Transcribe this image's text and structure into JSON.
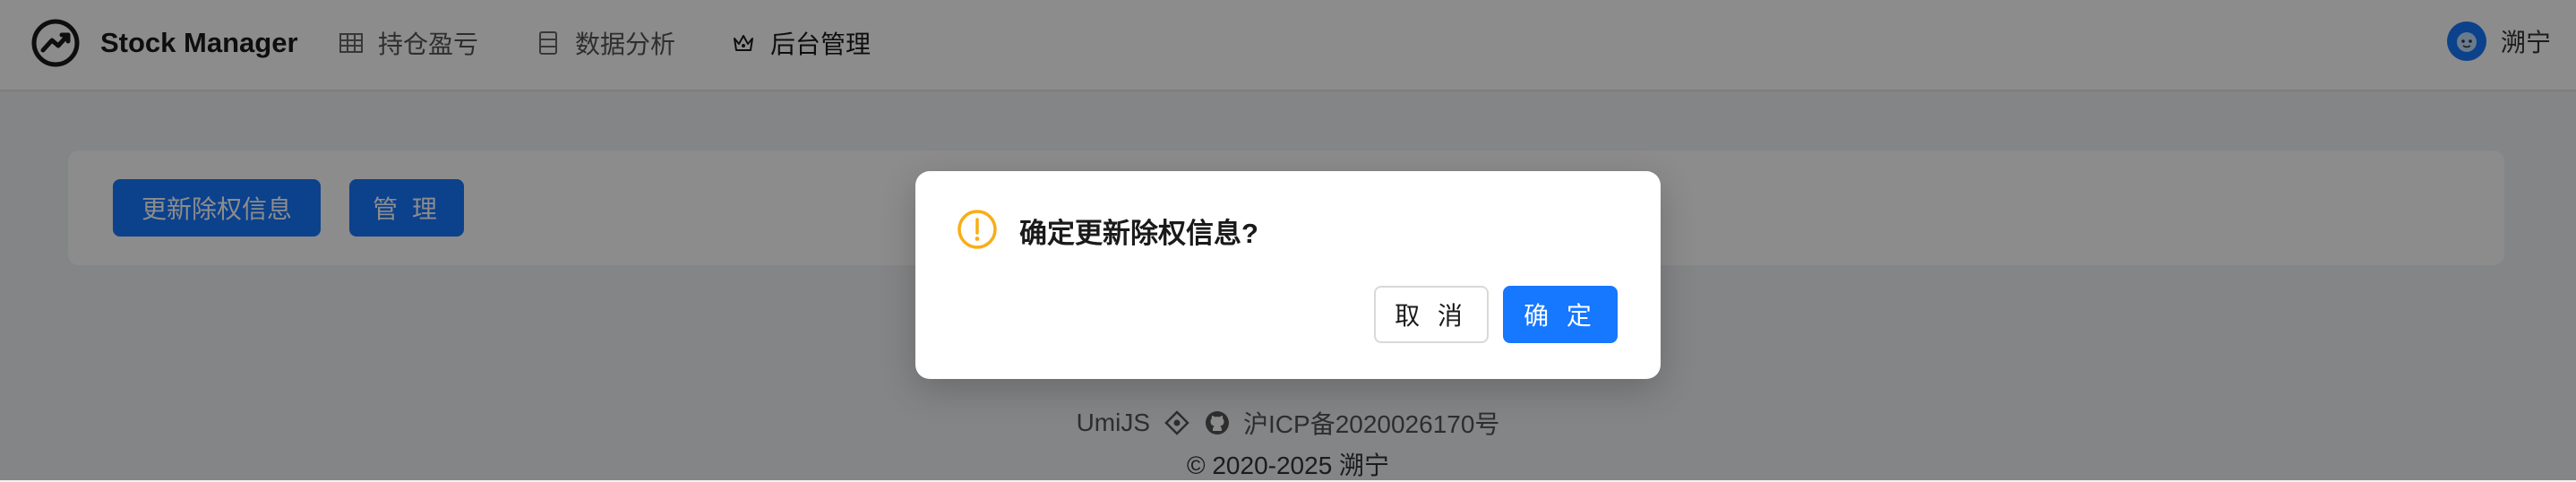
{
  "header": {
    "app_title": "Stock Manager",
    "nav": [
      {
        "label": "持仓盈亏",
        "icon": "table-icon"
      },
      {
        "label": "数据分析",
        "icon": "database-icon"
      },
      {
        "label": "后台管理",
        "icon": "crown-icon"
      }
    ],
    "user_name": "溯宁"
  },
  "content": {
    "update_button": "更新除权信息",
    "manage_button": "管 理"
  },
  "footer": {
    "links": [
      "UmiJS",
      "沪ICP备2020026170号"
    ],
    "copyright": "© 2020-2025 溯宁"
  },
  "modal": {
    "message": "确定更新除权信息?",
    "cancel_label": "取 消",
    "ok_label": "确 定",
    "icon": "exclamation-circle-icon"
  },
  "colors": {
    "primary": "#1677ff",
    "warning": "#faad14",
    "mask": "rgba(0,0,0,0.45)"
  }
}
